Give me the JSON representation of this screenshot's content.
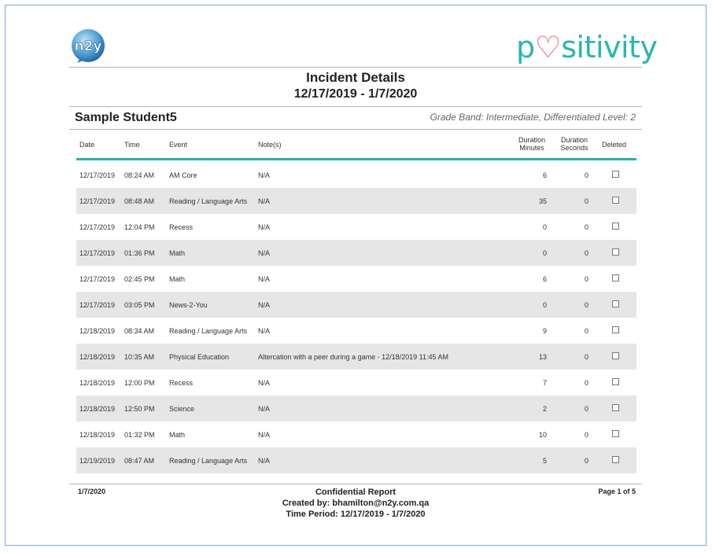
{
  "header": {
    "brand_left": "n2y",
    "brand_right_pre": "p",
    "brand_right_post": "sitivity",
    "title": "Incident Details",
    "date_range": "12/17/2019 - 1/7/2020"
  },
  "student": {
    "name": "Sample Student5",
    "grade_info": "Grade Band: Intermediate, Differentiated Level: 2"
  },
  "columns": {
    "date": "Date",
    "time": "Time",
    "event": "Event",
    "notes": "Note(s)",
    "duration_minutes_1": "Duration",
    "duration_minutes_2": "Minutes",
    "duration_seconds_1": "Duration",
    "duration_seconds_2": "Seconds",
    "deleted": "Deleted"
  },
  "rows": [
    {
      "date": "12/17/2019",
      "time": "08:24 AM",
      "event": "AM Core",
      "notes": "N/A",
      "minutes": "6",
      "seconds": "0",
      "deleted": false
    },
    {
      "date": "12/17/2019",
      "time": "08:48 AM",
      "event": "Reading / Language Arts",
      "notes": "N/A",
      "minutes": "35",
      "seconds": "0",
      "deleted": false
    },
    {
      "date": "12/17/2019",
      "time": "12:04 PM",
      "event": "Recess",
      "notes": "N/A",
      "minutes": "0",
      "seconds": "0",
      "deleted": false
    },
    {
      "date": "12/17/2019",
      "time": "01:36 PM",
      "event": "Math",
      "notes": "N/A",
      "minutes": "0",
      "seconds": "0",
      "deleted": false
    },
    {
      "date": "12/17/2019",
      "time": "02:45 PM",
      "event": "Math",
      "notes": "N/A",
      "minutes": "6",
      "seconds": "0",
      "deleted": false
    },
    {
      "date": "12/17/2019",
      "time": "03:05 PM",
      "event": "News-2-You",
      "notes": "N/A",
      "minutes": "0",
      "seconds": "0",
      "deleted": false
    },
    {
      "date": "12/18/2019",
      "time": "08:34 AM",
      "event": "Reading / Language Arts",
      "notes": "N/A",
      "minutes": "9",
      "seconds": "0",
      "deleted": false
    },
    {
      "date": "12/18/2019",
      "time": "10:35 AM",
      "event": "Physical Education",
      "notes": "Altercation with a peer during a game - 12/18/2019 11:45 AM",
      "minutes": "13",
      "seconds": "0",
      "deleted": false
    },
    {
      "date": "12/18/2019",
      "time": "12:00 PM",
      "event": "Recess",
      "notes": "N/A",
      "minutes": "7",
      "seconds": "0",
      "deleted": false
    },
    {
      "date": "12/18/2019",
      "time": "12:50 PM",
      "event": "Science",
      "notes": "N/A",
      "minutes": "2",
      "seconds": "0",
      "deleted": false
    },
    {
      "date": "12/18/2019",
      "time": "01:32 PM",
      "event": "Math",
      "notes": "N/A",
      "minutes": "10",
      "seconds": "0",
      "deleted": false
    },
    {
      "date": "12/19/2019",
      "time": "08:47 AM",
      "event": "Reading / Language Arts",
      "notes": "N/A",
      "minutes": "5",
      "seconds": "0",
      "deleted": false
    }
  ],
  "footer": {
    "date": "1/7/2020",
    "page": "Page 1 of 5",
    "confidential": "Confidential Report",
    "created_by": "Created by: bhamilton@n2y.com.qa",
    "time_period": "Time Period: 12/17/2019 - 1/7/2020"
  }
}
